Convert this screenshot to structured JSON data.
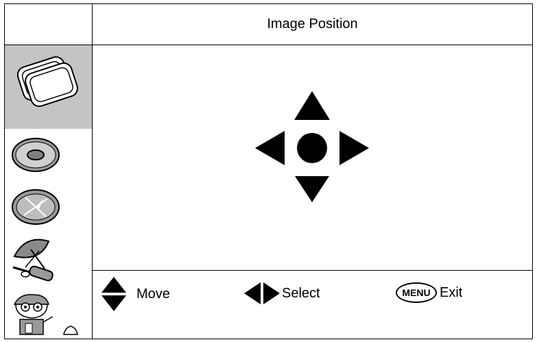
{
  "header": {
    "title": "Image Position"
  },
  "sidebar": {
    "items": [
      {
        "icon": "overlapping-frames-icon",
        "selected": true
      },
      {
        "icon": "disc-icon",
        "selected": false
      },
      {
        "icon": "compass-dial-icon",
        "selected": false
      },
      {
        "icon": "satellite-dish-icon",
        "selected": false
      },
      {
        "icon": "cartoon-character-icon",
        "selected": false
      }
    ]
  },
  "footer": {
    "move_label": "Move",
    "select_label": "Select",
    "menu_key_label": "MENU",
    "exit_label": "Exit"
  },
  "colors": {
    "selected_bg": "#c4c4c4",
    "icon_fill": "#000000"
  }
}
